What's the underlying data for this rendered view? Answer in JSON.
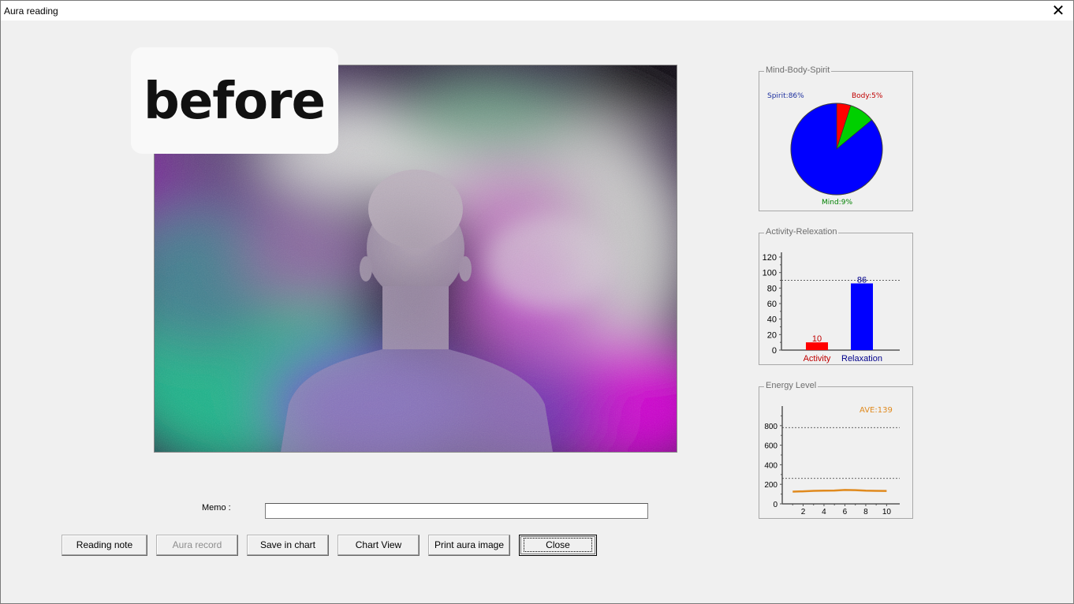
{
  "window": {
    "title": "Aura reading"
  },
  "overlay": {
    "text": "before"
  },
  "memo": {
    "label": "Memo :",
    "value": ""
  },
  "buttons": {
    "reading_note": "Reading note",
    "aura_record": "Aura record",
    "save_in_chart": "Save in chart",
    "chart_view": "Chart View",
    "print_aura_image": "Print aura image",
    "close": "Close"
  },
  "chart_data": [
    {
      "type": "pie",
      "title": "Mind-Body-Spirit",
      "slices": [
        {
          "label": "Spirit:86%",
          "value": 86,
          "color": "#0000ff"
        },
        {
          "label": "Body:5%",
          "value": 5,
          "color": "#ff0000"
        },
        {
          "label": "Mind:9%",
          "value": 9,
          "color": "#00d000"
        }
      ],
      "label_colors": {
        "spirit": "#1c2f9e",
        "body": "#c00000",
        "mind": "#008000"
      }
    },
    {
      "type": "bar",
      "title": "Activity-Relexation",
      "categories": [
        "Activity",
        "Relaxation"
      ],
      "values": [
        10,
        86
      ],
      "value_labels": [
        "10",
        "86"
      ],
      "colors": [
        "#ff0000",
        "#0000ff"
      ],
      "label_colors": [
        "#c00000",
        "#00008b"
      ],
      "yticks": [
        "0",
        "20",
        "40",
        "60",
        "80",
        "100",
        "120"
      ],
      "ylim": [
        0,
        120
      ],
      "reference_line": 90
    },
    {
      "type": "line",
      "title": "Energy Level",
      "annotation": "AVE:139",
      "color": "#e08a1e",
      "x": [
        1,
        2,
        3,
        4,
        5,
        6,
        7,
        8,
        9,
        10
      ],
      "values": [
        125,
        128,
        133,
        135,
        136,
        142,
        140,
        135,
        133,
        132
      ],
      "xticks": [
        "2",
        "4",
        "6",
        "8",
        "10"
      ],
      "yticks": [
        "0",
        "200",
        "400",
        "600",
        "800"
      ],
      "ylim": [
        0,
        1000
      ],
      "xlim": [
        0,
        10.5
      ],
      "reference_lines": [
        780,
        260
      ]
    }
  ]
}
